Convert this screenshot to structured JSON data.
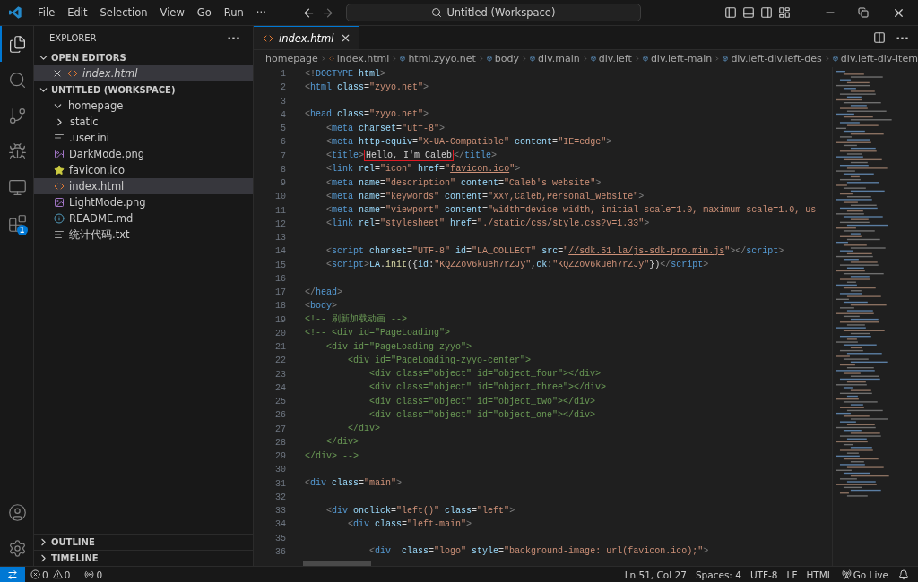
{
  "title_bar": {
    "menus": [
      "File",
      "Edit",
      "Selection",
      "View",
      "Go",
      "Run"
    ],
    "more": "···",
    "command_center": "Untitled (Workspace)"
  },
  "activity_bar": {
    "items": [
      {
        "kind": "explorer",
        "selected": true
      },
      {
        "kind": "search",
        "selected": false
      },
      {
        "kind": "source-control",
        "selected": false
      },
      {
        "kind": "run-debug",
        "selected": false
      },
      {
        "kind": "remote",
        "selected": false
      },
      {
        "kind": "extensions",
        "selected": false,
        "badge": "1"
      }
    ],
    "bottom": [
      {
        "kind": "account"
      },
      {
        "kind": "settings"
      }
    ]
  },
  "sidebar": {
    "title": "EXPLORER",
    "more": "···",
    "open_editors": {
      "label": "OPEN EDITORS",
      "expanded": true,
      "items": [
        {
          "name": "index.html",
          "kind": "html",
          "selected": true
        }
      ]
    },
    "workspace": {
      "label": "UNTITLED (WORKSPACE)",
      "expanded": true,
      "items": [
        {
          "name": "homepage",
          "kind": "folder",
          "expanded": true,
          "selected": false,
          "children": [
            {
              "name": "static",
              "kind": "folder",
              "expanded": false,
              "selected": false
            },
            {
              "name": ".user.ini",
              "kind": "text",
              "selected": false
            },
            {
              "name": "DarkMode.png",
              "kind": "image",
              "selected": false
            },
            {
              "name": "favicon.ico",
              "kind": "star",
              "selected": false
            },
            {
              "name": "index.html",
              "kind": "html",
              "selected": true
            },
            {
              "name": "LightMode.png",
              "kind": "image",
              "selected": false
            },
            {
              "name": "README.md",
              "kind": "info",
              "selected": false
            },
            {
              "name": "统计代码.txt",
              "kind": "text",
              "selected": false
            }
          ]
        }
      ]
    },
    "collapsed_sections": [
      {
        "label": "OUTLINE",
        "expanded": false
      },
      {
        "label": "TIMELINE",
        "expanded": false
      }
    ]
  },
  "editor": {
    "tabs": [
      {
        "label": "index.html",
        "selected": true,
        "preview": true
      }
    ],
    "more": "···",
    "breadcrumbs": [
      {
        "label": "homepage",
        "kind": "folder"
      },
      {
        "label": "index.html",
        "kind": "file"
      },
      {
        "label": "html.zyyo.net",
        "kind": "symbol"
      },
      {
        "label": "body",
        "kind": "symbol"
      },
      {
        "label": "div.main",
        "kind": "symbol"
      },
      {
        "label": "div.left",
        "kind": "symbol"
      },
      {
        "label": "div.left-main",
        "kind": "symbol"
      },
      {
        "label": "div.left-div.left-des",
        "kind": "symbol"
      },
      {
        "label": "div.left-div-item",
        "kind": "symbol"
      }
    ],
    "lines": [
      {
        "number": "1",
        "tokens": [
          {
            "kind": "punct",
            "text": "<!"
          },
          {
            "kind": "tag",
            "text": "DOCTYPE"
          },
          {
            "kind": "attr",
            "text": " html"
          },
          {
            "kind": "punct",
            "text": ">"
          }
        ]
      },
      {
        "number": "2",
        "tokens": [
          {
            "kind": "punct",
            "text": "<"
          },
          {
            "kind": "tag",
            "text": "html"
          },
          {
            "kind": "attr",
            "text": " class"
          },
          {
            "kind": "text",
            "text": "="
          },
          {
            "kind": "string",
            "text": "\"zyyo.net\""
          },
          {
            "kind": "punct",
            "text": ">"
          }
        ]
      },
      {
        "number": "3"
      },
      {
        "number": "4",
        "tokens": [
          {
            "kind": "punct",
            "text": "<"
          },
          {
            "kind": "tag",
            "text": "head"
          },
          {
            "kind": "attr",
            "text": " class"
          },
          {
            "kind": "text",
            "text": "="
          },
          {
            "kind": "string",
            "text": "\"zyyo.net\""
          },
          {
            "kind": "punct",
            "text": ">"
          }
        ]
      },
      {
        "number": "5",
        "tokens": [
          {
            "kind": "punct",
            "text": "    <"
          },
          {
            "kind": "tag",
            "text": "meta"
          },
          {
            "kind": "attr",
            "text": " charset"
          },
          {
            "kind": "text",
            "text": "="
          },
          {
            "kind": "string",
            "text": "\"utf-8\""
          },
          {
            "kind": "punct",
            "text": ">"
          }
        ]
      },
      {
        "number": "6",
        "tokens": [
          {
            "kind": "punct",
            "text": "    <"
          },
          {
            "kind": "tag",
            "text": "meta"
          },
          {
            "kind": "attr",
            "text": " http-equiv"
          },
          {
            "kind": "text",
            "text": "="
          },
          {
            "kind": "string",
            "text": "\"X-UA-Compatible\""
          },
          {
            "kind": "attr",
            "text": " content"
          },
          {
            "kind": "text",
            "text": "="
          },
          {
            "kind": "string",
            "text": "\"IE=edge\""
          },
          {
            "kind": "punct",
            "text": ">"
          }
        ]
      },
      {
        "number": "7",
        "tokens": [
          {
            "kind": "punct",
            "text": "    <"
          },
          {
            "kind": "tag",
            "text": "title"
          },
          {
            "kind": "punct",
            "text": ">"
          },
          {
            "kind": "boxed",
            "text": "Hello, I'm Caleb"
          },
          {
            "kind": "punct",
            "text": "</"
          },
          {
            "kind": "tag",
            "text": "title"
          },
          {
            "kind": "punct",
            "text": ">"
          }
        ]
      },
      {
        "number": "8",
        "tokens": [
          {
            "kind": "punct",
            "text": "    <"
          },
          {
            "kind": "tag",
            "text": "link"
          },
          {
            "kind": "attr",
            "text": " rel"
          },
          {
            "kind": "text",
            "text": "="
          },
          {
            "kind": "string",
            "text": "\"icon\""
          },
          {
            "kind": "attr",
            "text": " href"
          },
          {
            "kind": "text",
            "text": "="
          },
          {
            "kind": "string",
            "text": "\""
          },
          {
            "kind": "link",
            "text": "favicon.ico"
          },
          {
            "kind": "string",
            "text": "\""
          },
          {
            "kind": "punct",
            "text": ">"
          }
        ]
      },
      {
        "number": "9",
        "tokens": [
          {
            "kind": "punct",
            "text": "    <"
          },
          {
            "kind": "tag",
            "text": "meta"
          },
          {
            "kind": "attr",
            "text": " name"
          },
          {
            "kind": "text",
            "text": "="
          },
          {
            "kind": "string",
            "text": "\"description\""
          },
          {
            "kind": "attr",
            "text": " content"
          },
          {
            "kind": "text",
            "text": "="
          },
          {
            "kind": "string",
            "text": "\"Caleb's website\""
          },
          {
            "kind": "punct",
            "text": ">"
          }
        ]
      },
      {
        "number": "10",
        "tokens": [
          {
            "kind": "punct",
            "text": "    <"
          },
          {
            "kind": "tag",
            "text": "meta"
          },
          {
            "kind": "attr",
            "text": " name"
          },
          {
            "kind": "text",
            "text": "="
          },
          {
            "kind": "string",
            "text": "\"keywords\""
          },
          {
            "kind": "attr",
            "text": " content"
          },
          {
            "kind": "text",
            "text": "="
          },
          {
            "kind": "string",
            "text": "\"XXY,Caleb,Personal_Website\""
          },
          {
            "kind": "punct",
            "text": ">"
          }
        ]
      },
      {
        "number": "11",
        "tokens": [
          {
            "kind": "punct",
            "text": "    <"
          },
          {
            "kind": "tag",
            "text": "meta"
          },
          {
            "kind": "attr",
            "text": " name"
          },
          {
            "kind": "text",
            "text": "="
          },
          {
            "kind": "string",
            "text": "\"viewport\""
          },
          {
            "kind": "attr",
            "text": " content"
          },
          {
            "kind": "text",
            "text": "="
          },
          {
            "kind": "string",
            "text": "\"width=device-width, initial-scale=1.0, maximum-scale=1.0, us"
          }
        ]
      },
      {
        "number": "12",
        "tokens": [
          {
            "kind": "punct",
            "text": "    <"
          },
          {
            "kind": "tag",
            "text": "link"
          },
          {
            "kind": "attr",
            "text": " rel"
          },
          {
            "kind": "text",
            "text": "="
          },
          {
            "kind": "string",
            "text": "\"stylesheet\""
          },
          {
            "kind": "attr",
            "text": " href"
          },
          {
            "kind": "text",
            "text": "="
          },
          {
            "kind": "string",
            "text": "\""
          },
          {
            "kind": "link",
            "text": "./static/css/style.css?v=1.33"
          },
          {
            "kind": "string",
            "text": "\""
          },
          {
            "kind": "punct",
            "text": ">"
          }
        ]
      },
      {
        "number": "13"
      },
      {
        "number": "14",
        "tokens": [
          {
            "kind": "punct",
            "text": "    <"
          },
          {
            "kind": "tag",
            "text": "script"
          },
          {
            "kind": "attr",
            "text": " charset"
          },
          {
            "kind": "text",
            "text": "="
          },
          {
            "kind": "string",
            "text": "\"UTF-8\""
          },
          {
            "kind": "attr",
            "text": " id"
          },
          {
            "kind": "text",
            "text": "="
          },
          {
            "kind": "string",
            "text": "\"LA_COLLECT\""
          },
          {
            "kind": "attr",
            "text": " src"
          },
          {
            "kind": "text",
            "text": "="
          },
          {
            "kind": "string",
            "text": "\""
          },
          {
            "kind": "link",
            "text": "//sdk.51.la/js-sdk-pro.min.js"
          },
          {
            "kind": "string",
            "text": "\""
          },
          {
            "kind": "punct",
            "text": "></"
          },
          {
            "kind": "tag",
            "text": "script"
          },
          {
            "kind": "punct",
            "text": ">"
          }
        ]
      },
      {
        "number": "15",
        "tokens": [
          {
            "kind": "punct",
            "text": "    <"
          },
          {
            "kind": "tag",
            "text": "script"
          },
          {
            "kind": "punct",
            "text": ">"
          },
          {
            "kind": "attr",
            "text": "LA"
          },
          {
            "kind": "text",
            "text": "."
          },
          {
            "kind": "func",
            "text": "init"
          },
          {
            "kind": "text",
            "text": "({"
          },
          {
            "kind": "attr",
            "text": "id"
          },
          {
            "kind": "text",
            "text": ":"
          },
          {
            "kind": "string",
            "text": "\"KQZZoV6kueh7rZJy\""
          },
          {
            "kind": "text",
            "text": ","
          },
          {
            "kind": "attr",
            "text": "ck"
          },
          {
            "kind": "text",
            "text": ":"
          },
          {
            "kind": "string",
            "text": "\"KQZZoV6kueh7rZJy\""
          },
          {
            "kind": "text",
            "text": "})"
          },
          {
            "kind": "punct",
            "text": "</"
          },
          {
            "kind": "tag",
            "text": "script"
          },
          {
            "kind": "punct",
            "text": ">"
          }
        ]
      },
      {
        "number": "16"
      },
      {
        "number": "17",
        "tokens": [
          {
            "kind": "punct",
            "text": "</"
          },
          {
            "kind": "tag",
            "text": "head"
          },
          {
            "kind": "punct",
            "text": ">"
          }
        ]
      },
      {
        "number": "18",
        "tokens": [
          {
            "kind": "punct",
            "text": "<"
          },
          {
            "kind": "tag",
            "text": "body"
          },
          {
            "kind": "punct",
            "text": ">"
          }
        ]
      },
      {
        "number": "19",
        "tokens": [
          {
            "kind": "comment",
            "text": "<!-- 刷新加载动画 -->"
          }
        ]
      },
      {
        "number": "20",
        "tokens": [
          {
            "kind": "comment",
            "text": "<!-- <div id=\"PageLoading\">"
          }
        ]
      },
      {
        "number": "21",
        "tokens": [
          {
            "kind": "comment",
            "text": "    <div id=\"PageLoading-zyyo\">"
          }
        ]
      },
      {
        "number": "22",
        "tokens": [
          {
            "kind": "comment",
            "text": "        <div id=\"PageLoading-zyyo-center\">"
          }
        ]
      },
      {
        "number": "23",
        "tokens": [
          {
            "kind": "comment",
            "text": "            <div class=\"object\" id=\"object_four\"></div>"
          }
        ]
      },
      {
        "number": "24",
        "tokens": [
          {
            "kind": "comment",
            "text": "            <div class=\"object\" id=\"object_three\"></div>"
          }
        ]
      },
      {
        "number": "25",
        "tokens": [
          {
            "kind": "comment",
            "text": "            <div class=\"object\" id=\"object_two\"></div>"
          }
        ]
      },
      {
        "number": "26",
        "tokens": [
          {
            "kind": "comment",
            "text": "            <div class=\"object\" id=\"object_one\"></div>"
          }
        ]
      },
      {
        "number": "27",
        "tokens": [
          {
            "kind": "comment",
            "text": "        </div>"
          }
        ]
      },
      {
        "number": "28",
        "tokens": [
          {
            "kind": "comment",
            "text": "    </div>"
          }
        ]
      },
      {
        "number": "29",
        "tokens": [
          {
            "kind": "comment",
            "text": "</div> -->"
          }
        ]
      },
      {
        "number": "30"
      },
      {
        "number": "31",
        "tokens": [
          {
            "kind": "punct",
            "text": "<"
          },
          {
            "kind": "tag",
            "text": "div"
          },
          {
            "kind": "attr",
            "text": " class"
          },
          {
            "kind": "text",
            "text": "="
          },
          {
            "kind": "string",
            "text": "\"main\""
          },
          {
            "kind": "punct",
            "text": ">"
          }
        ]
      },
      {
        "number": "32"
      },
      {
        "number": "33",
        "tokens": [
          {
            "kind": "punct",
            "text": "    <"
          },
          {
            "kind": "tag",
            "text": "div"
          },
          {
            "kind": "attr",
            "text": " onclick"
          },
          {
            "kind": "text",
            "text": "="
          },
          {
            "kind": "string",
            "text": "\"left()\""
          },
          {
            "kind": "attr",
            "text": " class"
          },
          {
            "kind": "text",
            "text": "="
          },
          {
            "kind": "string",
            "text": "\"left\""
          },
          {
            "kind": "punct",
            "text": ">"
          }
        ]
      },
      {
        "number": "34",
        "tokens": [
          {
            "kind": "punct",
            "text": "        <"
          },
          {
            "kind": "tag",
            "text": "div"
          },
          {
            "kind": "attr",
            "text": " class"
          },
          {
            "kind": "text",
            "text": "="
          },
          {
            "kind": "string",
            "text": "\"left-main\""
          },
          {
            "kind": "punct",
            "text": ">"
          }
        ]
      },
      {
        "number": "35"
      },
      {
        "number": "36",
        "tokens": [
          {
            "kind": "punct",
            "text": "            <"
          },
          {
            "kind": "tag",
            "text": "div"
          },
          {
            "kind": "attr",
            "text": "  class"
          },
          {
            "kind": "text",
            "text": "="
          },
          {
            "kind": "string",
            "text": "\"logo\""
          },
          {
            "kind": "attr",
            "text": " style"
          },
          {
            "kind": "text",
            "text": "="
          },
          {
            "kind": "string",
            "text": "\"background-image: url(favicon.ico);\""
          },
          {
            "kind": "punct",
            "text": ">"
          }
        ]
      }
    ]
  },
  "status_bar": {
    "errors": "0",
    "warnings": "0",
    "ports": "0",
    "right": [
      {
        "kind": "text",
        "label": "Ln 51, Col 27"
      },
      {
        "kind": "text",
        "label": "Spaces: 4"
      },
      {
        "kind": "text",
        "label": "UTF-8"
      },
      {
        "kind": "text",
        "label": "LF"
      },
      {
        "kind": "text",
        "label": "HTML"
      },
      {
        "kind": "live",
        "label": "Go Live"
      },
      {
        "kind": "bell"
      }
    ]
  }
}
